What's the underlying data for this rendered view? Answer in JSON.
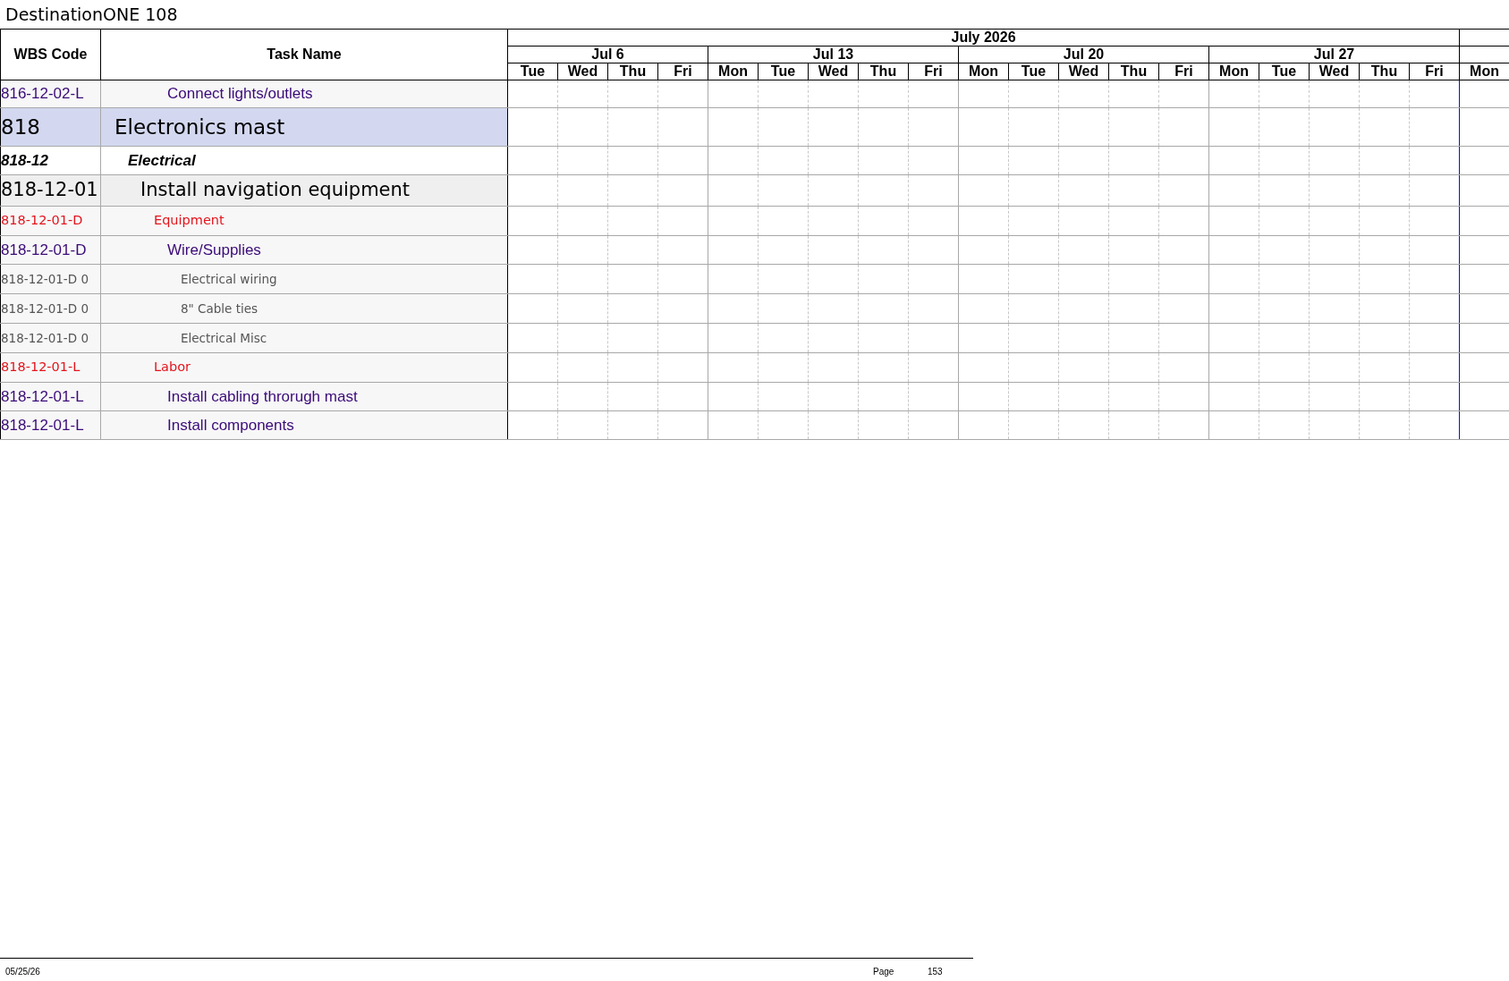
{
  "title": "DestinationONE 108",
  "columns": [
    "WBS Code",
    "Task Name"
  ],
  "timeline": {
    "month": "July 2026",
    "weeks": [
      {
        "label": "Jul 6",
        "days": [
          "Tue",
          "Wed",
          "Thu",
          "Fri"
        ]
      },
      {
        "label": "Jul 13",
        "days": [
          "Mon",
          "Tue",
          "Wed",
          "Thu",
          "Fri"
        ]
      },
      {
        "label": "Jul 20",
        "days": [
          "Mon",
          "Tue",
          "Wed",
          "Thu",
          "Fri"
        ]
      },
      {
        "label": "Jul 27",
        "days": [
          "Mon",
          "Tue",
          "Wed",
          "Thu",
          "Fri"
        ]
      },
      {
        "days": [
          "Mon"
        ]
      }
    ]
  },
  "tasks": [
    {
      "wbs": "816-12-02-L",
      "name": "Connect lights/outlets",
      "kind": "item"
    },
    {
      "wbs": "818",
      "name": "Electronics mast",
      "kind": "project"
    },
    {
      "wbs": "818-12",
      "name": "Electrical",
      "kind": "group"
    },
    {
      "wbs": "818-12-01",
      "name": "Install navigation equipment",
      "kind": "task"
    },
    {
      "wbs": "818-12-01-D",
      "name": "Equipment",
      "kind": "category"
    },
    {
      "wbs": "818-12-01-D",
      "name": "Wire/Supplies",
      "kind": "item"
    },
    {
      "wbs": "818-12-01-D 0",
      "name": "Electrical wiring",
      "kind": "detail"
    },
    {
      "wbs": "818-12-01-D 0",
      "name": "8\" Cable ties",
      "kind": "detail"
    },
    {
      "wbs": "818-12-01-D 0",
      "name": "Electrical Misc",
      "kind": "detail"
    },
    {
      "wbs": "818-12-01-L",
      "name": "Labor",
      "kind": "category"
    },
    {
      "wbs": "818-12-01-L",
      "name": "Install cabling throrugh mast",
      "kind": "item"
    },
    {
      "wbs": "818-12-01-L",
      "name": "Install components",
      "kind": "item"
    }
  ],
  "footer": {
    "date": "05/25/26",
    "page_label": "Page",
    "page_number": "153"
  }
}
